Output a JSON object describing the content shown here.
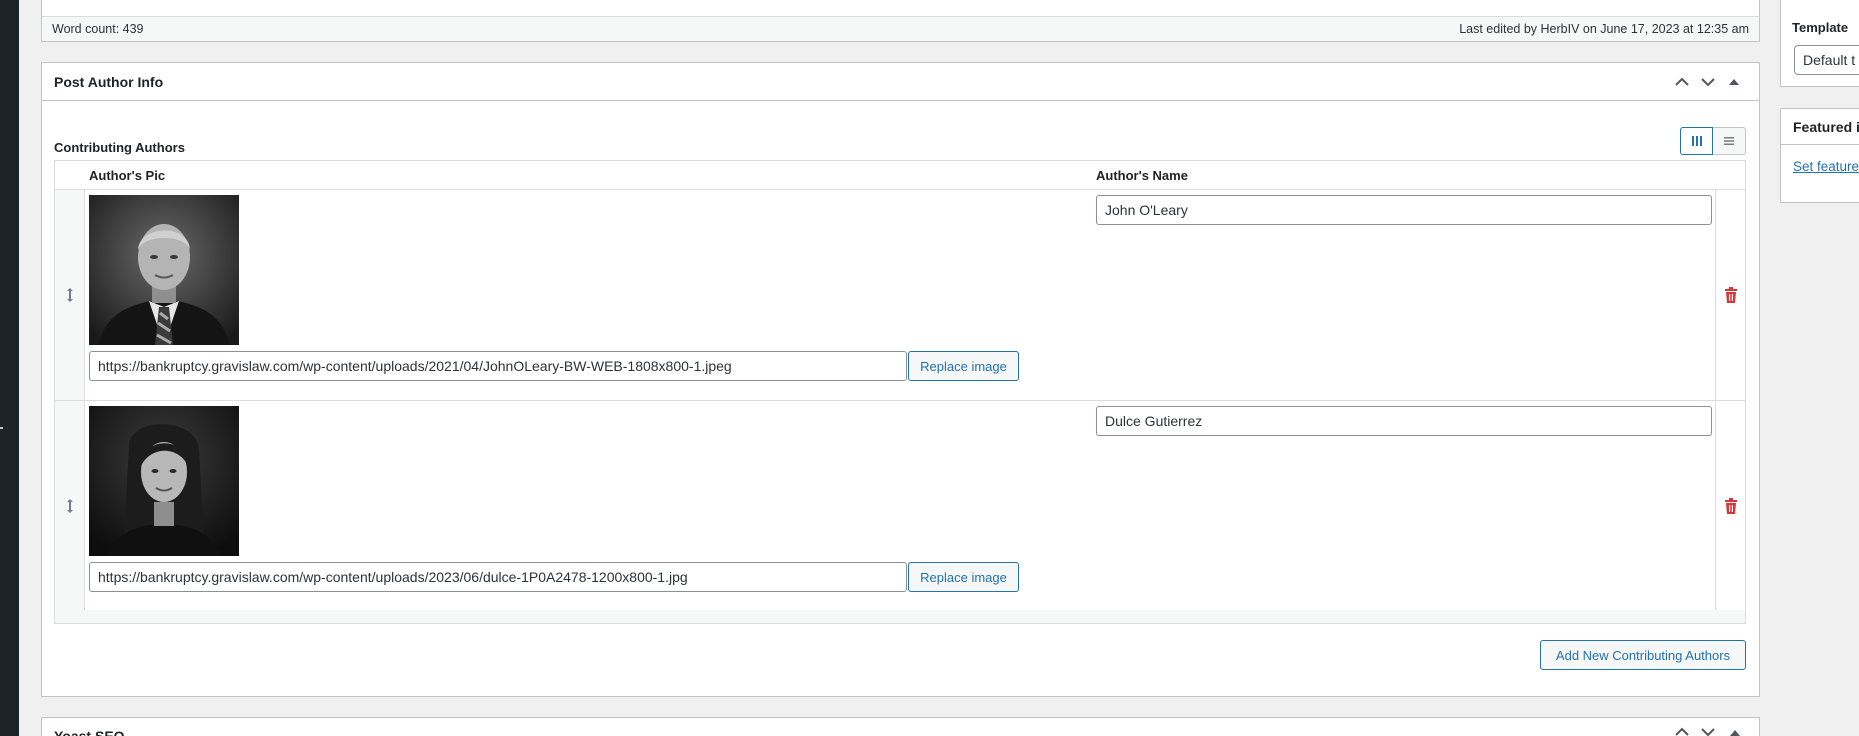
{
  "word_count_bar": {
    "word_count": "Word count: 439",
    "last_edited": "Last edited by HerbIV on June 17, 2023 at 12:35 am"
  },
  "post_author_box": {
    "title": "Post Author Info",
    "field_label": "Contributing Authors",
    "columns": {
      "pic": "Author's Pic",
      "name": "Author's Name"
    },
    "rows": [
      {
        "image_url": "https://bankruptcy.gravislaw.com/wp-content/uploads/2021/04/JohnOLeary-BW-WEB-1808x800-1.jpeg",
        "replace_label": "Replace image",
        "author_name": "John O'Leary"
      },
      {
        "image_url": "https://bankruptcy.gravislaw.com/wp-content/uploads/2023/06/dulce-1P0A2478-1200x800-1.jpg",
        "replace_label": "Replace image",
        "author_name": "Dulce Gutierrez"
      }
    ],
    "add_button": "Add New Contributing Authors"
  },
  "yoast_box": {
    "title": "Yoast SEO"
  },
  "sidebar": {
    "template_label": "Template",
    "template_value": "Default t",
    "featured_title": "Featured i",
    "featured_link": "Set feature"
  },
  "colors": {
    "accent": "#2271b1",
    "delete": "#d63638",
    "border": "#c3c4c7"
  }
}
